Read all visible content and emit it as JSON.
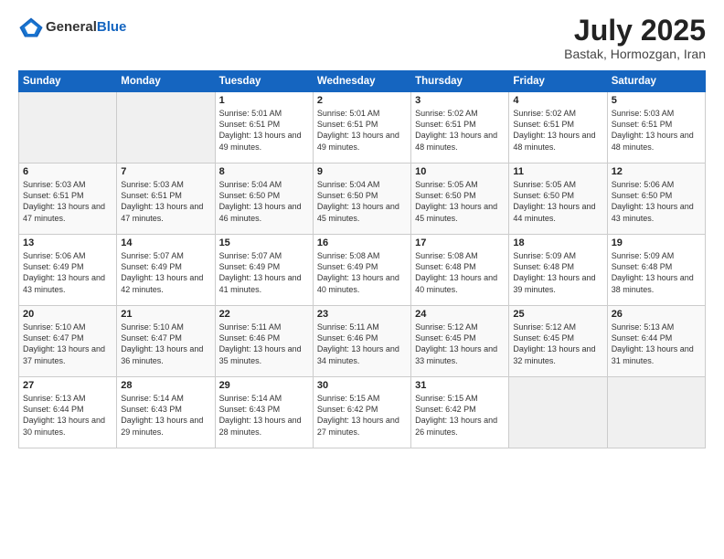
{
  "header": {
    "logo_general": "General",
    "logo_blue": "Blue",
    "title": "July 2025",
    "location": "Bastak, Hormozgan, Iran"
  },
  "days_of_week": [
    "Sunday",
    "Monday",
    "Tuesday",
    "Wednesday",
    "Thursday",
    "Friday",
    "Saturday"
  ],
  "weeks": [
    [
      {
        "day": "",
        "info": ""
      },
      {
        "day": "",
        "info": ""
      },
      {
        "day": "1",
        "info": "Sunrise: 5:01 AM\nSunset: 6:51 PM\nDaylight: 13 hours and 49 minutes."
      },
      {
        "day": "2",
        "info": "Sunrise: 5:01 AM\nSunset: 6:51 PM\nDaylight: 13 hours and 49 minutes."
      },
      {
        "day": "3",
        "info": "Sunrise: 5:02 AM\nSunset: 6:51 PM\nDaylight: 13 hours and 48 minutes."
      },
      {
        "day": "4",
        "info": "Sunrise: 5:02 AM\nSunset: 6:51 PM\nDaylight: 13 hours and 48 minutes."
      },
      {
        "day": "5",
        "info": "Sunrise: 5:03 AM\nSunset: 6:51 PM\nDaylight: 13 hours and 48 minutes."
      }
    ],
    [
      {
        "day": "6",
        "info": "Sunrise: 5:03 AM\nSunset: 6:51 PM\nDaylight: 13 hours and 47 minutes."
      },
      {
        "day": "7",
        "info": "Sunrise: 5:03 AM\nSunset: 6:51 PM\nDaylight: 13 hours and 47 minutes."
      },
      {
        "day": "8",
        "info": "Sunrise: 5:04 AM\nSunset: 6:50 PM\nDaylight: 13 hours and 46 minutes."
      },
      {
        "day": "9",
        "info": "Sunrise: 5:04 AM\nSunset: 6:50 PM\nDaylight: 13 hours and 45 minutes."
      },
      {
        "day": "10",
        "info": "Sunrise: 5:05 AM\nSunset: 6:50 PM\nDaylight: 13 hours and 45 minutes."
      },
      {
        "day": "11",
        "info": "Sunrise: 5:05 AM\nSunset: 6:50 PM\nDaylight: 13 hours and 44 minutes."
      },
      {
        "day": "12",
        "info": "Sunrise: 5:06 AM\nSunset: 6:50 PM\nDaylight: 13 hours and 43 minutes."
      }
    ],
    [
      {
        "day": "13",
        "info": "Sunrise: 5:06 AM\nSunset: 6:49 PM\nDaylight: 13 hours and 43 minutes."
      },
      {
        "day": "14",
        "info": "Sunrise: 5:07 AM\nSunset: 6:49 PM\nDaylight: 13 hours and 42 minutes."
      },
      {
        "day": "15",
        "info": "Sunrise: 5:07 AM\nSunset: 6:49 PM\nDaylight: 13 hours and 41 minutes."
      },
      {
        "day": "16",
        "info": "Sunrise: 5:08 AM\nSunset: 6:49 PM\nDaylight: 13 hours and 40 minutes."
      },
      {
        "day": "17",
        "info": "Sunrise: 5:08 AM\nSunset: 6:48 PM\nDaylight: 13 hours and 40 minutes."
      },
      {
        "day": "18",
        "info": "Sunrise: 5:09 AM\nSunset: 6:48 PM\nDaylight: 13 hours and 39 minutes."
      },
      {
        "day": "19",
        "info": "Sunrise: 5:09 AM\nSunset: 6:48 PM\nDaylight: 13 hours and 38 minutes."
      }
    ],
    [
      {
        "day": "20",
        "info": "Sunrise: 5:10 AM\nSunset: 6:47 PM\nDaylight: 13 hours and 37 minutes."
      },
      {
        "day": "21",
        "info": "Sunrise: 5:10 AM\nSunset: 6:47 PM\nDaylight: 13 hours and 36 minutes."
      },
      {
        "day": "22",
        "info": "Sunrise: 5:11 AM\nSunset: 6:46 PM\nDaylight: 13 hours and 35 minutes."
      },
      {
        "day": "23",
        "info": "Sunrise: 5:11 AM\nSunset: 6:46 PM\nDaylight: 13 hours and 34 minutes."
      },
      {
        "day": "24",
        "info": "Sunrise: 5:12 AM\nSunset: 6:45 PM\nDaylight: 13 hours and 33 minutes."
      },
      {
        "day": "25",
        "info": "Sunrise: 5:12 AM\nSunset: 6:45 PM\nDaylight: 13 hours and 32 minutes."
      },
      {
        "day": "26",
        "info": "Sunrise: 5:13 AM\nSunset: 6:44 PM\nDaylight: 13 hours and 31 minutes."
      }
    ],
    [
      {
        "day": "27",
        "info": "Sunrise: 5:13 AM\nSunset: 6:44 PM\nDaylight: 13 hours and 30 minutes."
      },
      {
        "day": "28",
        "info": "Sunrise: 5:14 AM\nSunset: 6:43 PM\nDaylight: 13 hours and 29 minutes."
      },
      {
        "day": "29",
        "info": "Sunrise: 5:14 AM\nSunset: 6:43 PM\nDaylight: 13 hours and 28 minutes."
      },
      {
        "day": "30",
        "info": "Sunrise: 5:15 AM\nSunset: 6:42 PM\nDaylight: 13 hours and 27 minutes."
      },
      {
        "day": "31",
        "info": "Sunrise: 5:15 AM\nSunset: 6:42 PM\nDaylight: 13 hours and 26 minutes."
      },
      {
        "day": "",
        "info": ""
      },
      {
        "day": "",
        "info": ""
      }
    ]
  ]
}
